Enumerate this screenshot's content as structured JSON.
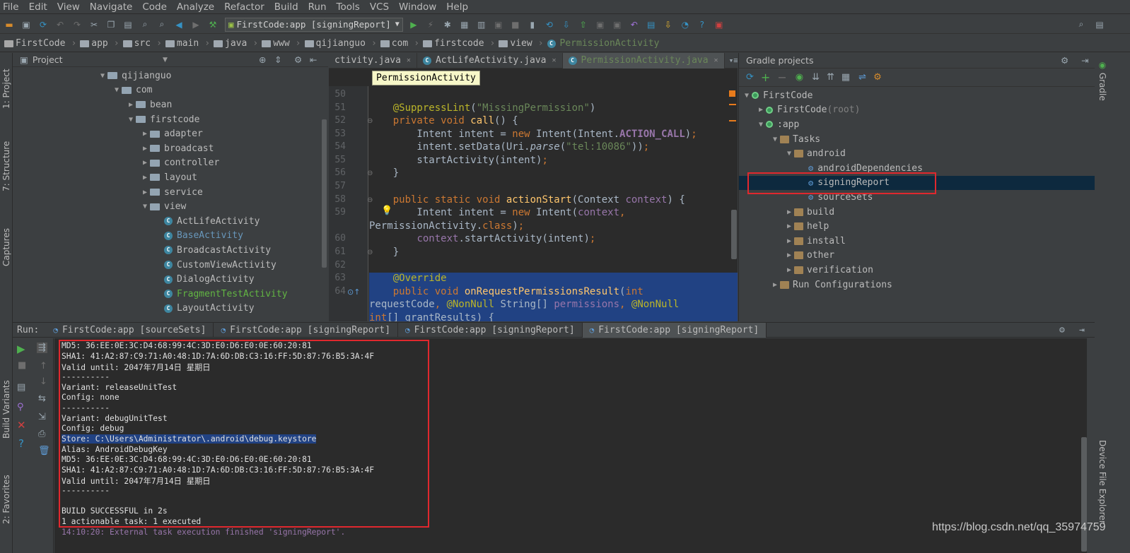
{
  "menu": [
    "File",
    "Edit",
    "View",
    "Navigate",
    "Code",
    "Analyze",
    "Refactor",
    "Build",
    "Run",
    "Tools",
    "VCS",
    "Window",
    "Help"
  ],
  "toolbar": {
    "run_config": "FirstCode:app [signingReport]"
  },
  "breadcrumbs": [
    "FirstCode",
    "app",
    "src",
    "main",
    "java",
    "www",
    "qijianguo",
    "com",
    "firstcode",
    "view",
    "PermissionActivity"
  ],
  "left_tabs": {
    "project": "1: Project",
    "structure": "7: Structure",
    "captures": "Captures",
    "build_variants": "Build Variants",
    "favorites": "2: Favorites"
  },
  "right_tabs": {
    "gradle": "Gradle",
    "device": "Device File Explorer"
  },
  "project_panel": {
    "title": "Project",
    "tree": [
      {
        "label": "qijianguo",
        "type": "pkg",
        "arrow": "open",
        "indent": 0
      },
      {
        "label": "com",
        "type": "pkg",
        "arrow": "open",
        "indent": 1
      },
      {
        "label": "bean",
        "type": "pkg",
        "arrow": "closed",
        "indent": 2
      },
      {
        "label": "firstcode",
        "type": "pkg",
        "arrow": "open",
        "indent": 2
      },
      {
        "label": "adapter",
        "type": "pkg",
        "arrow": "closed",
        "indent": 3
      },
      {
        "label": "broadcast",
        "type": "pkg",
        "arrow": "closed",
        "indent": 3
      },
      {
        "label": "controller",
        "type": "pkg",
        "arrow": "closed",
        "indent": 3
      },
      {
        "label": "layout",
        "type": "pkg",
        "arrow": "closed",
        "indent": 3
      },
      {
        "label": "service",
        "type": "pkg",
        "arrow": "closed",
        "indent": 3
      },
      {
        "label": "view",
        "type": "pkg",
        "arrow": "open",
        "indent": 3
      },
      {
        "label": "ActLifeActivity",
        "type": "cls",
        "indent": 4,
        "color": "#bbbbbb"
      },
      {
        "label": "BaseActivity",
        "type": "cls",
        "indent": 4,
        "color": "#6897bb"
      },
      {
        "label": "BroadcastActivity",
        "type": "cls",
        "indent": 4,
        "color": "#bbbbbb"
      },
      {
        "label": "CustomViewActivity",
        "type": "cls",
        "indent": 4,
        "color": "#bbbbbb"
      },
      {
        "label": "DialogActivity",
        "type": "cls",
        "indent": 4,
        "color": "#bbbbbb"
      },
      {
        "label": "FragmentTestActivity",
        "type": "cls",
        "indent": 4,
        "color": "#62b543"
      },
      {
        "label": "LayoutActivity",
        "type": "cls",
        "indent": 4,
        "color": "#bbbbbb"
      }
    ]
  },
  "editor": {
    "tabs": [
      {
        "label": "ctivity.java",
        "active": false
      },
      {
        "label": "ActLifeActivity.java",
        "active": false
      },
      {
        "label": "PermissionActivity.java",
        "active": true
      }
    ],
    "tooltip": "PermissionActivity",
    "line_numbers": [
      "50",
      "51",
      "52",
      "53",
      "54",
      "55",
      "56",
      "57",
      "58",
      "59",
      "",
      "60",
      "61",
      "62",
      "63",
      "64"
    ]
  },
  "gradle_panel": {
    "title": "Gradle projects",
    "tree": [
      {
        "label": "FirstCode",
        "icon": "gradle",
        "arrow": "open",
        "indent": 0
      },
      {
        "label": "FirstCode",
        "suffix": " (root)",
        "icon": "gradle",
        "arrow": "closed",
        "indent": 1
      },
      {
        "label": ":app",
        "icon": "gradle",
        "arrow": "open",
        "indent": 1
      },
      {
        "label": "Tasks",
        "icon": "folder",
        "arrow": "open",
        "indent": 2
      },
      {
        "label": "android",
        "icon": "folder",
        "arrow": "open",
        "indent": 3
      },
      {
        "label": "androidDependencies",
        "icon": "gear",
        "indent": 4
      },
      {
        "label": "signingReport",
        "icon": "gear",
        "indent": 4,
        "selected": true
      },
      {
        "label": "sourceSets",
        "icon": "gear",
        "indent": 4
      },
      {
        "label": "build",
        "icon": "folder",
        "arrow": "closed",
        "indent": 3
      },
      {
        "label": "help",
        "icon": "folder",
        "arrow": "closed",
        "indent": 3
      },
      {
        "label": "install",
        "icon": "folder",
        "arrow": "closed",
        "indent": 3
      },
      {
        "label": "other",
        "icon": "folder",
        "arrow": "closed",
        "indent": 3
      },
      {
        "label": "verification",
        "icon": "folder",
        "arrow": "closed",
        "indent": 3
      },
      {
        "label": "Run Configurations",
        "icon": "folder",
        "arrow": "closed",
        "indent": 2
      }
    ]
  },
  "run_panel": {
    "label": "Run:",
    "tabs": [
      {
        "label": "FirstCode:app [sourceSets]",
        "active": false
      },
      {
        "label": "FirstCode:app [signingReport]",
        "active": false
      },
      {
        "label": "FirstCode:app [signingReport]",
        "active": false
      },
      {
        "label": "FirstCode:app [signingReport]",
        "active": true
      }
    ],
    "console": [
      {
        "text": "MD5: 36:EE:0E:3C:D4:68:99:4C:3D:E0:D6:E0:0E:60:20:81"
      },
      {
        "text": "SHA1: 41:A2:87:C9:71:A0:48:1D:7A:6D:DB:C3:16:FF:5D:87:76:B5:3A:4F"
      },
      {
        "text": "Valid until: 2047年7月14日 星期日"
      },
      {
        "text": "----------"
      },
      {
        "text": "Variant: releaseUnitTest"
      },
      {
        "text": "Config: none"
      },
      {
        "text": "----------"
      },
      {
        "text": "Variant: debugUnitTest"
      },
      {
        "text": "Config: debug"
      },
      {
        "text": "Store: C:\\Users\\Administrator\\.android\\debug.keystore",
        "highlight": true
      },
      {
        "text": "Alias: AndroidDebugKey"
      },
      {
        "text": "MD5: 36:EE:0E:3C:D4:68:99:4C:3D:E0:D6:E0:0E:60:20:81"
      },
      {
        "text": "SHA1: 41:A2:87:C9:71:A0:48:1D:7A:6D:DB:C3:16:FF:5D:87:76:B5:3A:4F"
      },
      {
        "text": "Valid until: 2047年7月14日 星期日"
      },
      {
        "text": "----------"
      },
      {
        "text": ""
      },
      {
        "text": "BUILD SUCCESSFUL in 2s"
      },
      {
        "text": "1 actionable task: 1 executed"
      },
      {
        "text": "14:10:20: External task execution finished 'signingReport'.",
        "color": "#9876aa"
      }
    ]
  },
  "watermark": "https://blog.csdn.net/qq_35974759"
}
